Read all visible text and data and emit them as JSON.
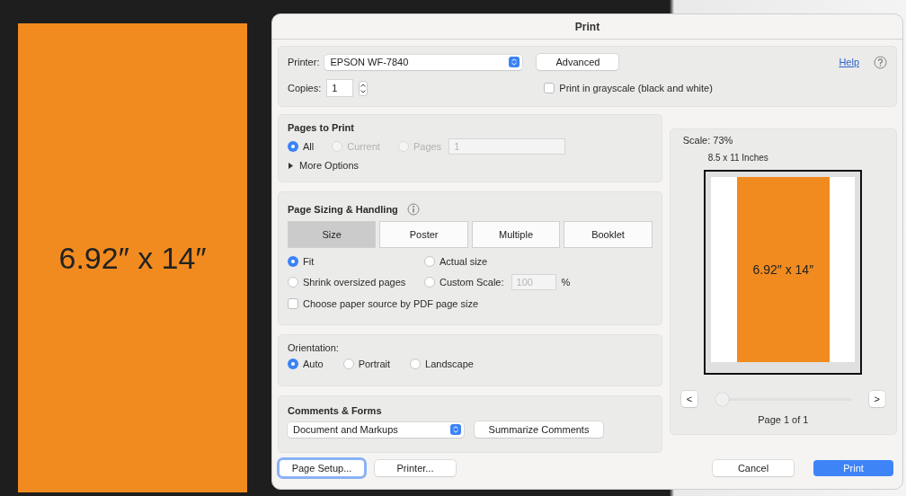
{
  "document": {
    "page_text": "6.92″ x 14″"
  },
  "dialog": {
    "title": "Print",
    "printer": {
      "label": "Printer:",
      "value": "EPSON WF-7840"
    },
    "advanced_button": "Advanced",
    "help_link": "Help",
    "copies": {
      "label": "Copies:",
      "value": "1"
    },
    "grayscale": {
      "label": "Print in grayscale (black and white)",
      "checked": false
    },
    "pages_to_print": {
      "title": "Pages to Print",
      "options": [
        {
          "label": "All",
          "selected": true,
          "disabled": false
        },
        {
          "label": "Current",
          "selected": false,
          "disabled": true
        },
        {
          "label": "Pages",
          "selected": false,
          "disabled": true
        }
      ],
      "pages_value": "1",
      "more_options": {
        "label": "More Options",
        "expanded": false
      }
    },
    "page_sizing": {
      "title": "Page Sizing & Handling",
      "tabs": [
        {
          "label": "Size",
          "selected": true
        },
        {
          "label": "Poster",
          "selected": false
        },
        {
          "label": "Multiple",
          "selected": false
        },
        {
          "label": "Booklet",
          "selected": false
        }
      ],
      "options": [
        {
          "label": "Fit",
          "selected": true
        },
        {
          "label": "Actual size",
          "selected": false
        },
        {
          "label": "Shrink oversized pages",
          "selected": false
        },
        {
          "label": "Custom Scale:",
          "selected": false
        }
      ],
      "custom_scale_value": "100",
      "percent": "%",
      "paper_source": {
        "label": "Choose paper source by PDF page size",
        "checked": false
      }
    },
    "orientation": {
      "title": "Orientation:",
      "options": [
        {
          "label": "Auto",
          "selected": true
        },
        {
          "label": "Portrait",
          "selected": false
        },
        {
          "label": "Landscape",
          "selected": false
        }
      ]
    },
    "comments_forms": {
      "title": "Comments & Forms",
      "select_value": "Document and Markups",
      "summarize_button": "Summarize Comments"
    },
    "preview": {
      "scale": "Scale:  73%",
      "paper_size": "8.5 x 11 Inches",
      "page_text": "6.92″ x 14″",
      "prev": "<",
      "next": ">",
      "page_slider": {
        "level": 0
      },
      "page_count": "Page 1 of 1"
    },
    "footer": {
      "left_buttons": [
        {
          "label": "Page Setup...",
          "focused": true
        },
        {
          "label": "Printer...",
          "focused": false
        }
      ],
      "cancel": "Cancel",
      "print": "Print"
    }
  }
}
